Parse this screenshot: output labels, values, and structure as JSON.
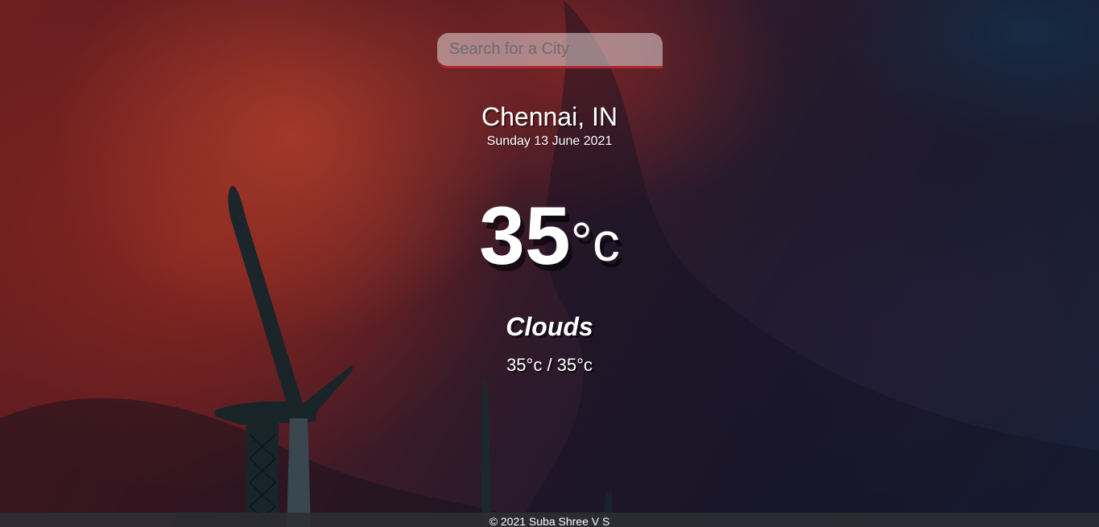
{
  "search": {
    "placeholder": "Search for a City"
  },
  "location": {
    "city": "Chennai, IN",
    "date": "Sunday 13 June 2021"
  },
  "current": {
    "temp_value": "35",
    "temp_unit": "°c"
  },
  "weather": {
    "description": "Clouds",
    "hi_low": "35°c / 35°c"
  },
  "footer": {
    "text": "© 2021 Suba Shree V S"
  },
  "colors": {
    "accent": "#b0262e",
    "text": "#ffffff",
    "footer_bg": "#2d2d34"
  },
  "icons": {
    "background": "wind-turbine-sunset-image"
  }
}
